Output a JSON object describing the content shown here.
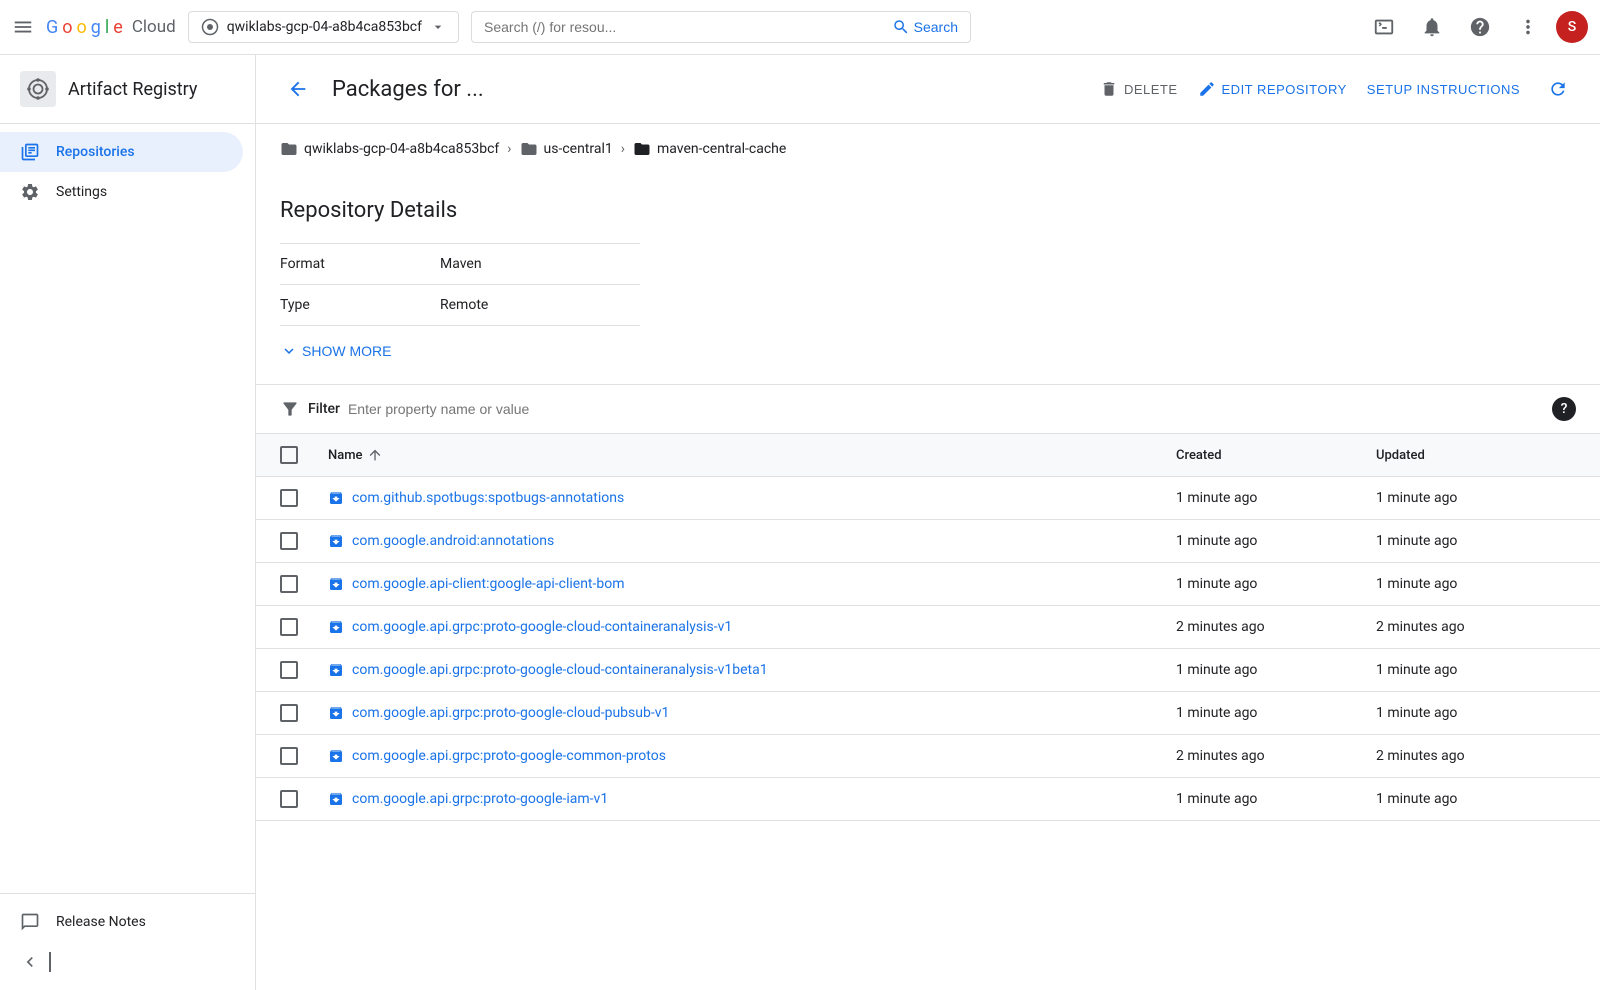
{
  "navbar": {
    "menu_icon": "☰",
    "google_logo": {
      "g": "G",
      "o1": "o",
      "o2": "o",
      "g2": "g",
      "l": "l",
      "e": "e",
      "cloud": "Cloud"
    },
    "project_name": "qwiklabs-gcp-04-a8b4ca853bcf",
    "search_placeholder": "Search (/) for resou...",
    "search_label": "Search",
    "icons": {
      "terminal": "▣",
      "bell": "🔔",
      "help": "?",
      "more": "⋮",
      "avatar": "S"
    }
  },
  "sidebar": {
    "logo_text": "AR",
    "title": "Artifact Registry",
    "nav_items": [
      {
        "id": "repositories",
        "label": "Repositories",
        "active": true
      },
      {
        "id": "settings",
        "label": "Settings",
        "active": false
      }
    ],
    "bottom_items": [
      {
        "id": "release-notes",
        "label": "Release Notes"
      }
    ],
    "collapse_label": "◀|"
  },
  "page_header": {
    "title": "Packages for ...",
    "back_icon": "←",
    "delete_label": "DELETE",
    "edit_label": "EDIT REPOSITORY",
    "setup_label": "SETUP INSTRUCTIONS",
    "refresh_icon": "↻"
  },
  "breadcrumb": {
    "items": [
      {
        "id": "project",
        "icon": "folder",
        "label": "qwiklabs-gcp-04-a8b4ca853bcf"
      },
      {
        "id": "location",
        "icon": "folder",
        "label": "us-central1"
      },
      {
        "id": "repo",
        "icon": "folder-dark",
        "label": "maven-central-cache"
      }
    ]
  },
  "repository_details": {
    "section_title": "Repository Details",
    "fields": [
      {
        "label": "Format",
        "value": "Maven"
      },
      {
        "label": "Type",
        "value": "Remote"
      }
    ],
    "show_more_label": "SHOW MORE",
    "show_more_icon": "❯"
  },
  "filter": {
    "icon": "≡",
    "label": "Filter",
    "placeholder": "Enter property name or value",
    "help_icon": "?"
  },
  "table": {
    "columns": [
      {
        "id": "checkbox",
        "label": ""
      },
      {
        "id": "name",
        "label": "Name",
        "sort_icon": "↑"
      },
      {
        "id": "created",
        "label": "Created"
      },
      {
        "id": "updated",
        "label": "Updated"
      }
    ],
    "rows": [
      {
        "id": "row-1",
        "name": "com.github.spotbugs:spotbugs-annotations",
        "created": "1 minute ago",
        "updated": "1 minute ago"
      },
      {
        "id": "row-2",
        "name": "com.google.android:annotations",
        "created": "1 minute ago",
        "updated": "1 minute ago"
      },
      {
        "id": "row-3",
        "name": "com.google.api-client:google-api-client-bom",
        "created": "1 minute ago",
        "updated": "1 minute ago"
      },
      {
        "id": "row-4",
        "name": "com.google.api.grpc:proto-google-cloud-containeranalysis-v1",
        "created": "2 minutes ago",
        "updated": "2 minutes ago"
      },
      {
        "id": "row-5",
        "name": "com.google.api.grpc:proto-google-cloud-containeranalysis-v1beta1",
        "created": "1 minute ago",
        "updated": "1 minute ago"
      },
      {
        "id": "row-6",
        "name": "com.google.api.grpc:proto-google-cloud-pubsub-v1",
        "created": "1 minute ago",
        "updated": "1 minute ago"
      },
      {
        "id": "row-7",
        "name": "com.google.api.grpc:proto-google-common-protos",
        "created": "2 minutes ago",
        "updated": "2 minutes ago"
      },
      {
        "id": "row-8",
        "name": "com.google.api.grpc:proto-google-iam-v1",
        "created": "1 minute ago",
        "updated": "1 minute ago"
      }
    ]
  },
  "colors": {
    "blue": "#1a73e8",
    "sidebar_active_bg": "#e8f0fe",
    "border": "#e0e0e0"
  }
}
